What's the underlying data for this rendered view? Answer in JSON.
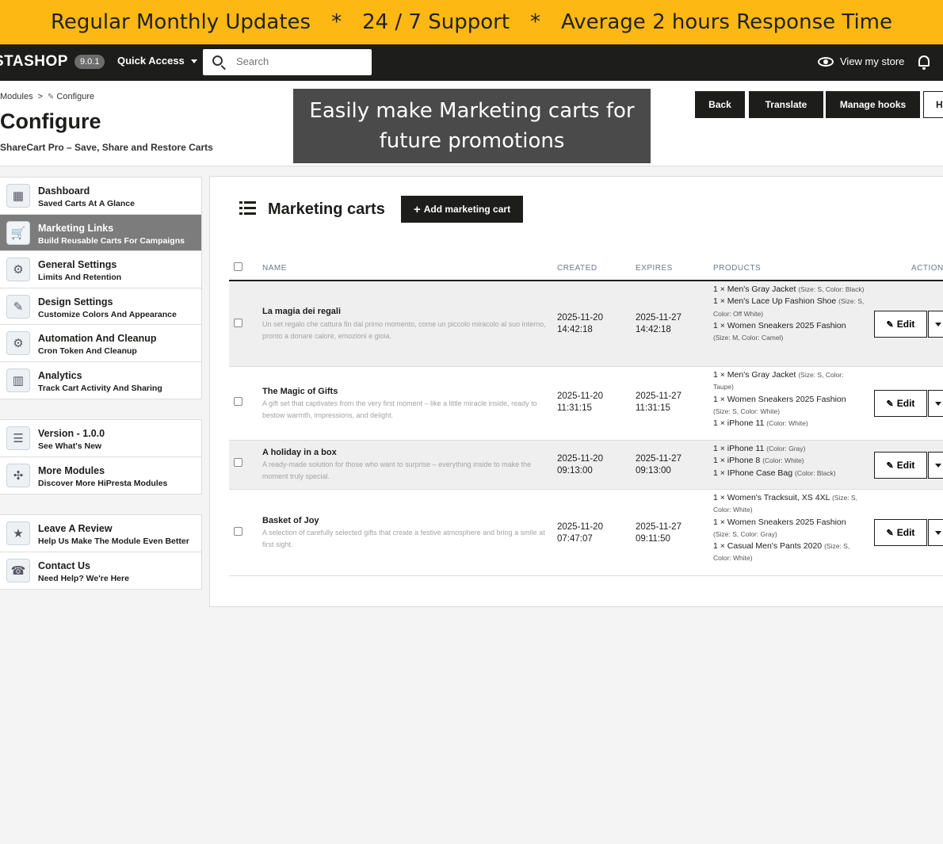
{
  "banner": {
    "item1": "Regular Monthly Updates",
    "sep1": "*",
    "item2": "24 / 7 Support",
    "sep2": "*",
    "item3": "Average 2 hours Response Time"
  },
  "topbar": {
    "logo": "STASHOP",
    "version": "9.0.1",
    "quick_access": "Quick Access",
    "search_placeholder": "Search",
    "view_store": "View my store"
  },
  "header": {
    "breadcrumb_modules": "Modules",
    "breadcrumb_sep": ">",
    "breadcrumb_configure": "Configure",
    "title": "Configure",
    "subtitle": "ShareCart Pro – Save, Share and Restore Carts",
    "caption": "Easily make Marketing carts for future promotions",
    "buttons": {
      "back": "Back",
      "translate": "Translate",
      "manage_hooks": "Manage hooks",
      "help": "H"
    }
  },
  "sidebar": {
    "groups": [
      [
        {
          "title": "Dashboard",
          "subtitle": "Saved Carts At A Glance",
          "icon": "dashboard-icon",
          "active": false
        },
        {
          "title": "Marketing Links",
          "subtitle": "Build Reusable Carts For Campaigns",
          "icon": "cart-icon",
          "active": true
        },
        {
          "title": "General Settings",
          "subtitle": "Limits And Retention",
          "icon": "gear-user-icon",
          "active": false
        },
        {
          "title": "Design Settings",
          "subtitle": "Customize Colors And Appearance",
          "icon": "palette-icon",
          "active": false
        },
        {
          "title": "Automation And Cleanup",
          "subtitle": "Cron Token And Cleanup",
          "icon": "automation-icon",
          "active": false
        },
        {
          "title": "Analytics",
          "subtitle": "Track Cart Activity And Sharing",
          "icon": "analytics-icon",
          "active": false
        }
      ],
      [
        {
          "title": "Version - 1.0.0",
          "subtitle": "See What's New",
          "icon": "changelog-icon",
          "active": false
        },
        {
          "title": "More Modules",
          "subtitle": "Discover More HiPresta Modules",
          "icon": "modules-icon",
          "active": false
        }
      ],
      [
        {
          "title": "Leave A Review",
          "subtitle": "Help Us Make The Module Even Better",
          "icon": "review-icon",
          "active": false
        },
        {
          "title": "Contact Us",
          "subtitle": "Need Help? We're Here",
          "icon": "support-icon",
          "active": false
        }
      ]
    ]
  },
  "panel": {
    "title": "Marketing carts",
    "add_button": "Add marketing cart",
    "columns": {
      "name": "NAME",
      "created": "CREATED",
      "expires": "EXPIRES",
      "products": "PRODUCTS",
      "actions": "ACTIONS"
    },
    "edit_label": "Edit",
    "rows": [
      {
        "name": "La magia dei regali",
        "description": "Un set regalo che cattura fin dal primo momento, come un piccolo miracolo al suo interno, pronto a donare calore, emozioni e gioia.",
        "created_date": "2025-11-20",
        "created_time": "14:42:18",
        "expires_date": "2025-11-27",
        "expires_time": "14:42:18",
        "products": [
          {
            "name": "1 × Men's Gray Jacket",
            "attrs": "(Size: S, Color: Black)"
          },
          {
            "name": "1 × Men's Lace Up Fashion Shoe",
            "attrs": "(Size: S, Color: Off White)"
          },
          {
            "name": "1 × Women Sneakers 2025 Fashion",
            "attrs": "(Size: M, Color: Camel)"
          }
        ]
      },
      {
        "name": "The Magic of Gifts",
        "description": "A gift set that captivates from the very first moment – like a little miracle inside, ready to bestow warmth, impressions, and delight.",
        "created_date": "2025-11-20",
        "created_time": "11:31:15",
        "expires_date": "2025-11-27",
        "expires_time": "11:31:15",
        "products": [
          {
            "name": "1 × Men's Gray Jacket",
            "attrs": "(Size: S, Color: Taupe)"
          },
          {
            "name": "1 × Women Sneakers 2025 Fashion",
            "attrs": "(Size: S, Color: White)"
          },
          {
            "name": "1 × iPhone 11",
            "attrs": "(Color: White)"
          }
        ]
      },
      {
        "name": "A holiday in a box",
        "description": "A ready-made solution for those who want to surprise – everything inside to make the moment truly special.",
        "created_date": "2025-11-20",
        "created_time": "09:13:00",
        "expires_date": "2025-11-27",
        "expires_time": "09:13:00",
        "products": [
          {
            "name": "1 × iPhone 11",
            "attrs": "(Color: Gray)"
          },
          {
            "name": "1 × iPhone 8",
            "attrs": "(Color: White)"
          },
          {
            "name": "1 × IPhone Case Bag",
            "attrs": "(Color: Black)"
          }
        ]
      },
      {
        "name": "Basket of Joy",
        "description": "A selection of carefully selected gifts that create a festive atmosphere and bring a smile at first sight.",
        "created_date": "2025-11-20",
        "created_time": "07:47:07",
        "expires_date": "2025-11-27",
        "expires_time": "09:11:50",
        "products": [
          {
            "name": "1 × Women's Tracksuit, XS 4XL",
            "attrs": "(Size: S, Color: White)"
          },
          {
            "name": "1 × Women Sneakers 2025 Fashion",
            "attrs": "(Size: S, Color: Gray)"
          },
          {
            "name": "1 × Casual Men's Pants 2020",
            "attrs": "(Size: S, Color: White)"
          }
        ]
      }
    ]
  },
  "colors": {
    "banner": "#fdb813",
    "topbar": "#1d1d1b",
    "active_sidebar": "#7c7c7c",
    "caption_bg": "#4a4a4a"
  }
}
